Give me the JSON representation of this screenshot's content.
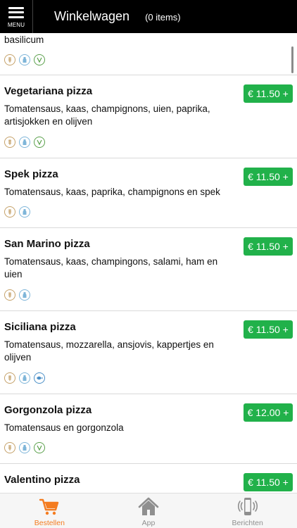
{
  "header": {
    "menu_label": "MENU",
    "title": "Winkelwagen",
    "count": "(0 items)"
  },
  "partial_item": {
    "desc": "basilicum",
    "icons": [
      "wheat-icon",
      "milk-icon",
      "vegetarian-icon"
    ]
  },
  "items": [
    {
      "name": "Vegetariana pizza",
      "desc": "Tomatensaus, kaas, champignons, uien, paprika, artisjokken en olijven",
      "price": "€ 11.50 +",
      "icons": [
        "wheat-icon",
        "milk-icon",
        "vegetarian-icon"
      ]
    },
    {
      "name": "Spek pizza",
      "desc": "Tomatensaus, kaas, paprika, champignons en spek",
      "price": "€ 11.50 +",
      "icons": [
        "wheat-icon",
        "milk-icon"
      ]
    },
    {
      "name": "San Marino pizza",
      "desc": "Tomatensaus, kaas, champingons, salami, ham en uien",
      "price": "€ 11.50 +",
      "icons": [
        "wheat-icon",
        "milk-icon"
      ]
    },
    {
      "name": "Siciliana pizza",
      "desc": "Tomatensaus, mozzarella, ansjovis, kappertjes en olijven",
      "price": "€ 11.50 +",
      "icons": [
        "wheat-icon",
        "milk-icon",
        "fish-icon"
      ]
    },
    {
      "name": "Gorgonzola pizza",
      "desc": "Tomatensaus en gorgonzola",
      "price": "€ 12.00 +",
      "icons": [
        "wheat-icon",
        "milk-icon",
        "vegetarian-icon"
      ]
    },
    {
      "name": "Valentino pizza",
      "desc": "",
      "price": "€ 11.50 +",
      "icons": []
    }
  ],
  "tabs": [
    {
      "label": "Bestellen",
      "icon": "cart-icon",
      "active": true
    },
    {
      "label": "App",
      "icon": "home-icon",
      "active": false
    },
    {
      "label": "Berichten",
      "icon": "phone-notification-icon",
      "active": false
    }
  ],
  "colors": {
    "header_bg": "#000000",
    "price_green": "#21b14a",
    "active_tab": "#f47c20",
    "inactive_tab": "#8f8f8f"
  }
}
